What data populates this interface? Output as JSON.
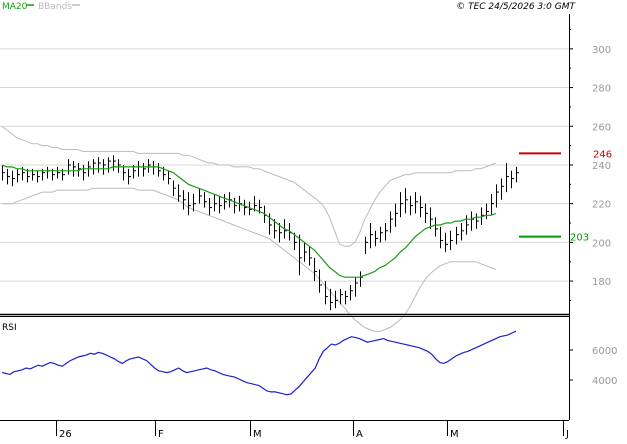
{
  "header": {
    "legend": [
      {
        "label": "MA20",
        "color": "#1a9a1a"
      },
      {
        "label": "BBands",
        "color": "#bbbbbb"
      }
    ],
    "copyright": "© TEC 24/5/2026 3:0 GMT"
  },
  "colors": {
    "price": "#000000",
    "ma": "#1a9a1a",
    "bands": "#bbbbbb",
    "rsi": "#1f1fcc",
    "resistance": "#cc0000",
    "support": "#009900",
    "grid": "#d8d8d8",
    "frame": "#000000",
    "tick_text": "#999999"
  },
  "chart_data": [
    {
      "type": "ohlc",
      "title": "",
      "x_labels": [
        "26",
        "F",
        "M",
        "A",
        "M",
        "J"
      ],
      "y_ticks": [
        180,
        200,
        220,
        240,
        260,
        280,
        300
      ],
      "ylim": [
        163,
        318
      ],
      "grid": true,
      "price_bars": [
        {
          "h": 240,
          "l": 232,
          "c": 236
        },
        {
          "h": 238,
          "l": 230,
          "c": 234
        },
        {
          "h": 237,
          "l": 229,
          "c": 233
        },
        {
          "h": 238,
          "l": 231,
          "c": 235
        },
        {
          "h": 239,
          "l": 232,
          "c": 236
        },
        {
          "h": 238,
          "l": 231,
          "c": 234
        },
        {
          "h": 238,
          "l": 232,
          "c": 235
        },
        {
          "h": 237,
          "l": 231,
          "c": 234
        },
        {
          "h": 238,
          "l": 232,
          "c": 236
        },
        {
          "h": 239,
          "l": 233,
          "c": 237
        },
        {
          "h": 238,
          "l": 232,
          "c": 235
        },
        {
          "h": 239,
          "l": 233,
          "c": 236
        },
        {
          "h": 238,
          "l": 232,
          "c": 235
        },
        {
          "h": 243,
          "l": 235,
          "c": 240
        },
        {
          "h": 242,
          "l": 234,
          "c": 239
        },
        {
          "h": 241,
          "l": 234,
          "c": 238
        },
        {
          "h": 240,
          "l": 232,
          "c": 236
        },
        {
          "h": 242,
          "l": 234,
          "c": 239
        },
        {
          "h": 243,
          "l": 235,
          "c": 241
        },
        {
          "h": 244,
          "l": 236,
          "c": 241
        },
        {
          "h": 243,
          "l": 235,
          "c": 240
        },
        {
          "h": 244,
          "l": 236,
          "c": 242
        },
        {
          "h": 245,
          "l": 237,
          "c": 242
        },
        {
          "h": 243,
          "l": 236,
          "c": 240
        },
        {
          "h": 240,
          "l": 232,
          "c": 236
        },
        {
          "h": 238,
          "l": 230,
          "c": 234
        },
        {
          "h": 240,
          "l": 233,
          "c": 237
        },
        {
          "h": 242,
          "l": 234,
          "c": 239
        },
        {
          "h": 241,
          "l": 234,
          "c": 238
        },
        {
          "h": 243,
          "l": 236,
          "c": 240
        },
        {
          "h": 242,
          "l": 235,
          "c": 239
        },
        {
          "h": 241,
          "l": 234,
          "c": 237
        },
        {
          "h": 239,
          "l": 232,
          "c": 235
        },
        {
          "h": 237,
          "l": 230,
          "c": 233
        },
        {
          "h": 232,
          "l": 224,
          "c": 228
        },
        {
          "h": 230,
          "l": 221,
          "c": 224
        },
        {
          "h": 227,
          "l": 217,
          "c": 222
        },
        {
          "h": 226,
          "l": 214,
          "c": 219
        },
        {
          "h": 225,
          "l": 216,
          "c": 220
        },
        {
          "h": 228,
          "l": 220,
          "c": 224
        },
        {
          "h": 226,
          "l": 218,
          "c": 221
        },
        {
          "h": 223,
          "l": 214,
          "c": 218
        },
        {
          "h": 225,
          "l": 216,
          "c": 220
        },
        {
          "h": 224,
          "l": 215,
          "c": 219
        },
        {
          "h": 225,
          "l": 217,
          "c": 221
        },
        {
          "h": 226,
          "l": 218,
          "c": 222
        },
        {
          "h": 223,
          "l": 215,
          "c": 219
        },
        {
          "h": 224,
          "l": 216,
          "c": 220
        },
        {
          "h": 222,
          "l": 214,
          "c": 218
        },
        {
          "h": 221,
          "l": 214,
          "c": 217
        },
        {
          "h": 224,
          "l": 216,
          "c": 219
        },
        {
          "h": 222,
          "l": 215,
          "c": 218
        },
        {
          "h": 219,
          "l": 210,
          "c": 214
        },
        {
          "h": 215,
          "l": 204,
          "c": 209
        },
        {
          "h": 212,
          "l": 202,
          "c": 206
        },
        {
          "h": 210,
          "l": 200,
          "c": 205
        },
        {
          "h": 212,
          "l": 202,
          "c": 206
        },
        {
          "h": 210,
          "l": 201,
          "c": 205
        },
        {
          "h": 205,
          "l": 196,
          "c": 200
        },
        {
          "h": 204,
          "l": 183,
          "c": 192
        },
        {
          "h": 200,
          "l": 190,
          "c": 195
        },
        {
          "h": 198,
          "l": 188,
          "c": 192
        },
        {
          "h": 192,
          "l": 180,
          "c": 185
        },
        {
          "h": 186,
          "l": 174,
          "c": 178
        },
        {
          "h": 180,
          "l": 168,
          "c": 172
        },
        {
          "h": 176,
          "l": 165,
          "c": 169
        },
        {
          "h": 175,
          "l": 166,
          "c": 170
        },
        {
          "h": 176,
          "l": 168,
          "c": 173
        },
        {
          "h": 175,
          "l": 168,
          "c": 172
        },
        {
          "h": 178,
          "l": 170,
          "c": 175
        },
        {
          "h": 182,
          "l": 172,
          "c": 179
        },
        {
          "h": 185,
          "l": 177,
          "c": 182
        },
        {
          "h": 203,
          "l": 194,
          "c": 200
        },
        {
          "h": 210,
          "l": 197,
          "c": 204
        },
        {
          "h": 206,
          "l": 198,
          "c": 202
        },
        {
          "h": 208,
          "l": 200,
          "c": 205
        },
        {
          "h": 210,
          "l": 201,
          "c": 206
        },
        {
          "h": 216,
          "l": 205,
          "c": 212
        },
        {
          "h": 220,
          "l": 208,
          "c": 215
        },
        {
          "h": 226,
          "l": 213,
          "c": 220
        },
        {
          "h": 228,
          "l": 215,
          "c": 222
        },
        {
          "h": 224,
          "l": 214,
          "c": 219
        },
        {
          "h": 226,
          "l": 215,
          "c": 221
        },
        {
          "h": 224,
          "l": 213,
          "c": 218
        },
        {
          "h": 220,
          "l": 210,
          "c": 215
        },
        {
          "h": 218,
          "l": 207,
          "c": 212
        },
        {
          "h": 213,
          "l": 203,
          "c": 207
        },
        {
          "h": 208,
          "l": 197,
          "c": 201
        },
        {
          "h": 205,
          "l": 195,
          "c": 199
        },
        {
          "h": 206,
          "l": 196,
          "c": 201
        },
        {
          "h": 208,
          "l": 199,
          "c": 204
        },
        {
          "h": 210,
          "l": 201,
          "c": 206
        },
        {
          "h": 214,
          "l": 204,
          "c": 209
        },
        {
          "h": 216,
          "l": 206,
          "c": 212
        },
        {
          "h": 215,
          "l": 207,
          "c": 211
        },
        {
          "h": 218,
          "l": 209,
          "c": 214
        },
        {
          "h": 220,
          "l": 212,
          "c": 216
        },
        {
          "h": 225,
          "l": 214,
          "c": 220
        },
        {
          "h": 230,
          "l": 218,
          "c": 226
        },
        {
          "h": 233,
          "l": 222,
          "c": 229
        },
        {
          "h": 241,
          "l": 226,
          "c": 234
        },
        {
          "h": 237,
          "l": 228,
          "c": 233
        },
        {
          "h": 239,
          "l": 231,
          "c": 236
        }
      ],
      "ma20": [
        240,
        239,
        239,
        238,
        238,
        237,
        237,
        237,
        237,
        237,
        237,
        237,
        237,
        237,
        237,
        237,
        238,
        238,
        238,
        238,
        238,
        238,
        239,
        239,
        239,
        239,
        239,
        239,
        239,
        239,
        239,
        239,
        238,
        237,
        236,
        234,
        232,
        230,
        229,
        228,
        227,
        226,
        225,
        224,
        223,
        222,
        221,
        220,
        219,
        218,
        217,
        216,
        215,
        213,
        211,
        209,
        207,
        206,
        204,
        202,
        200,
        198,
        196,
        193,
        190,
        187,
        185,
        183,
        182,
        182,
        182,
        182,
        183,
        184,
        185,
        187,
        188,
        190,
        192,
        195,
        197,
        200,
        203,
        205,
        207,
        208,
        209,
        209,
        210,
        210,
        211,
        211,
        212,
        212,
        213,
        213,
        214,
        214,
        215
      ],
      "bb_upper": [
        260,
        258,
        256,
        254,
        253,
        252,
        251,
        251,
        250,
        250,
        249,
        249,
        248,
        248,
        248,
        248,
        247,
        247,
        247,
        247,
        247,
        247,
        247,
        247,
        247,
        247,
        247,
        246,
        246,
        246,
        246,
        246,
        246,
        246,
        246,
        246,
        245,
        245,
        244,
        243,
        242,
        241,
        241,
        240,
        240,
        240,
        239,
        239,
        239,
        239,
        238,
        238,
        237,
        236,
        235,
        234,
        233,
        232,
        231,
        229,
        227,
        225,
        223,
        221,
        218,
        213,
        206,
        199,
        198,
        198,
        200,
        205,
        212,
        217,
        222,
        226,
        229,
        232,
        233,
        234,
        235,
        235,
        236,
        236,
        236,
        236,
        236,
        236,
        236,
        236,
        237,
        237,
        237,
        237,
        238,
        238,
        239,
        240,
        241
      ],
      "bb_lower": [
        220,
        220,
        220,
        221,
        222,
        223,
        224,
        225,
        226,
        226,
        226,
        227,
        227,
        227,
        227,
        227,
        227,
        227,
        228,
        228,
        228,
        228,
        228,
        228,
        228,
        228,
        228,
        227,
        227,
        227,
        227,
        226,
        225,
        224,
        223,
        222,
        220,
        218,
        217,
        216,
        215,
        214,
        213,
        212,
        211,
        210,
        209,
        208,
        207,
        206,
        205,
        204,
        203,
        202,
        200,
        198,
        196,
        194,
        192,
        190,
        188,
        186,
        184,
        181,
        178,
        175,
        172,
        169,
        166,
        163,
        160,
        158,
        156,
        155,
        154,
        154,
        155,
        156,
        158,
        160,
        163,
        167,
        172,
        177,
        181,
        184,
        186,
        188,
        189,
        190,
        190,
        190,
        190,
        190,
        190,
        189,
        188,
        187,
        186
      ],
      "annotations": [
        {
          "label": "246",
          "value": 246,
          "role": "resistance"
        },
        {
          "label": "203",
          "value": 203,
          "role": "support"
        }
      ]
    },
    {
      "type": "line",
      "title": "",
      "ylabel": "RSI",
      "y_ticks_labels": [
        "6000",
        "4000"
      ],
      "ylim": [
        0,
        100
      ],
      "values": [
        45,
        44,
        43,
        46,
        47,
        48,
        50,
        49,
        51,
        53,
        52,
        54,
        56,
        55,
        53,
        52,
        55,
        58,
        60,
        62,
        63,
        64,
        66,
        65,
        67,
        66,
        64,
        62,
        60,
        57,
        55,
        58,
        60,
        61,
        62,
        60,
        58,
        54,
        50,
        47,
        46,
        45,
        46,
        48,
        50,
        47,
        45,
        46,
        47,
        48,
        49,
        50,
        48,
        47,
        45,
        43,
        42,
        41,
        40,
        38,
        36,
        34,
        33,
        32,
        31,
        28,
        25,
        24,
        24,
        23,
        22,
        21,
        22,
        26,
        30,
        35,
        40,
        45,
        50,
        60,
        68,
        72,
        76,
        75,
        77,
        80,
        82,
        84,
        83,
        82,
        80,
        78,
        79,
        80,
        81,
        82,
        80,
        79,
        78,
        77,
        76,
        75,
        74,
        73,
        72,
        70,
        68,
        65,
        60,
        56,
        55,
        57,
        60,
        63,
        65,
        67,
        68,
        70,
        72,
        74,
        76,
        78,
        80,
        82,
        84,
        85,
        86,
        88,
        90
      ]
    }
  ]
}
